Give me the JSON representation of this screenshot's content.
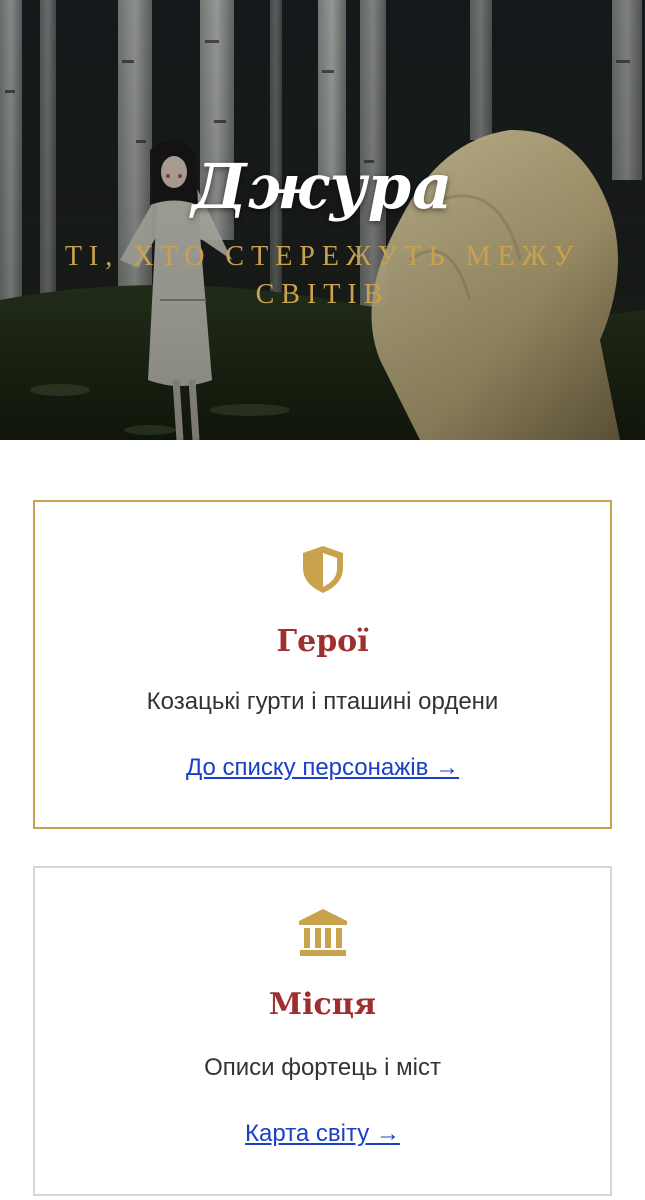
{
  "hero": {
    "title": "Джура",
    "subtitle": "ті, хто стережуть межу світів"
  },
  "cards": [
    {
      "icon": "shield-icon",
      "title": "Герої",
      "description": "Козацькі гурти і пташині ордени",
      "link": "До списку персонажів →"
    },
    {
      "icon": "building-columns-icon",
      "title": "Місця",
      "description": "Описи фортець і міст",
      "link": "Карта світу →"
    }
  ],
  "colors": {
    "accent_gold": "#c9a24e",
    "title_red": "#9e2f2f",
    "link_blue": "#1a3fc8"
  }
}
